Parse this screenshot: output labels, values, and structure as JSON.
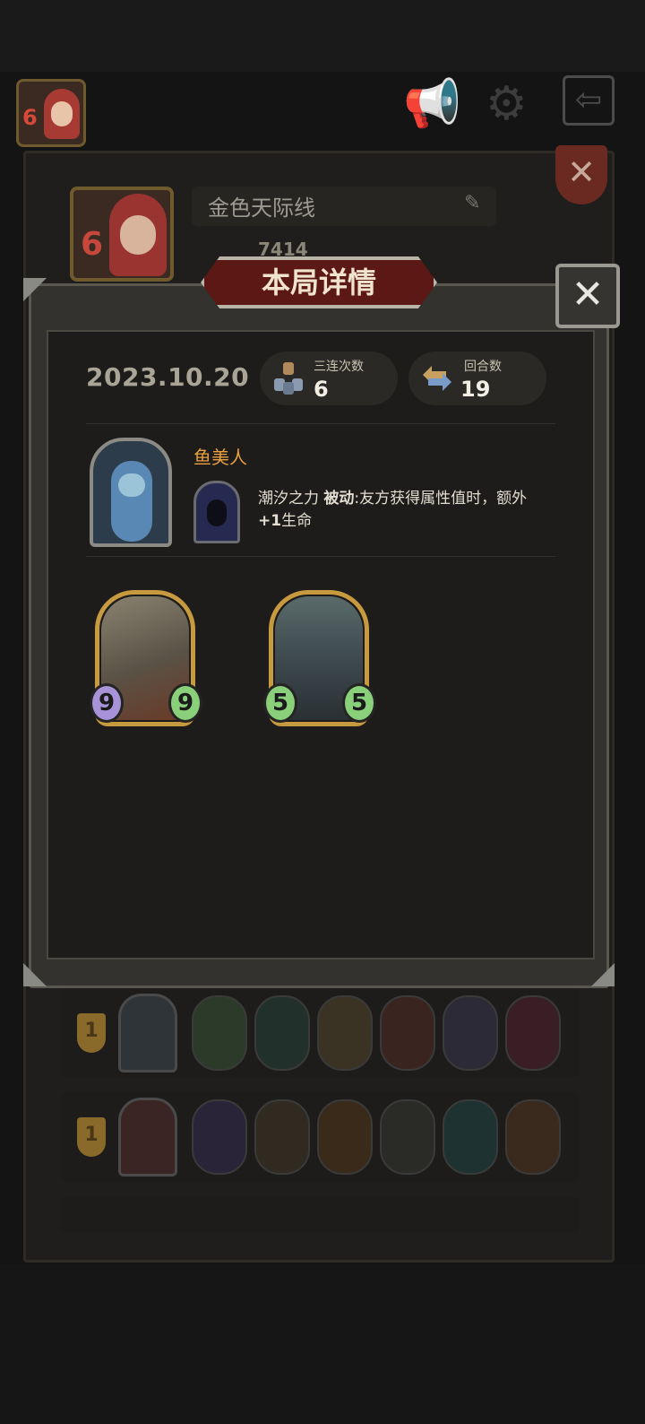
{
  "top_bar": {
    "avatar_level": "6",
    "icons": [
      "megaphone-icon",
      "gear-icon",
      "exit-icon"
    ]
  },
  "profile": {
    "name": "金色天际线",
    "score": "7414",
    "avatar_level": "6"
  },
  "modal": {
    "title": "本局详情",
    "date": "2023.10.20",
    "triples_label": "三连次数",
    "triples_value": "6",
    "turns_label": "回合数",
    "turns_value": "19",
    "hero_name": "鱼美人",
    "power_name": "潮汐之力",
    "power_type": "被动",
    "power_text": ":友方获得属性值时，额外",
    "power_bonus": "+1",
    "power_tail": "生命",
    "cards": [
      {
        "attack": "9",
        "health": "9"
      },
      {
        "attack": "5",
        "health": "5"
      }
    ]
  },
  "matches": [
    {
      "rank": "1"
    },
    {
      "rank": "1"
    }
  ]
}
